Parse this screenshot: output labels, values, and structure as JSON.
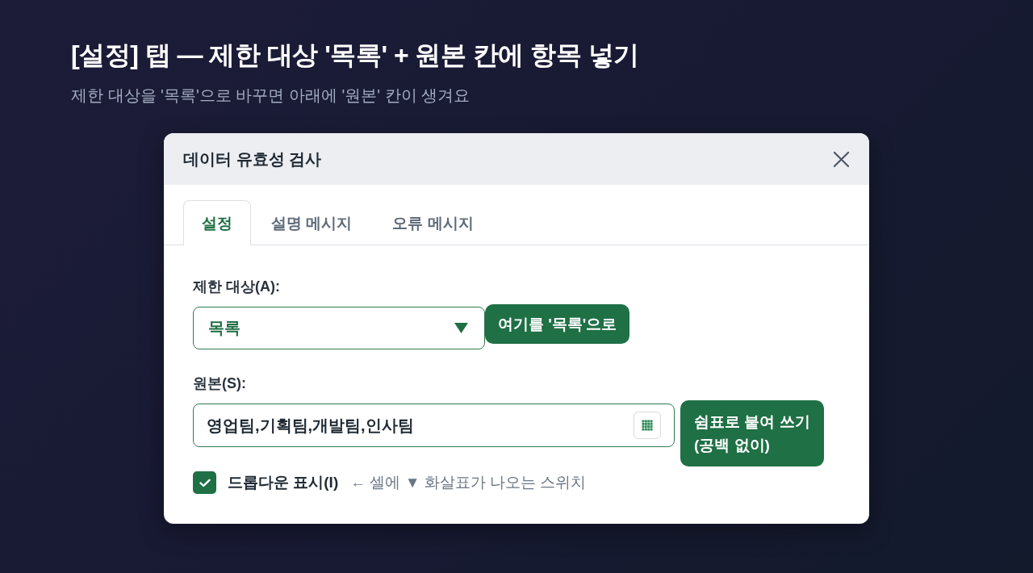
{
  "heading": {
    "title": "[설정] 탭 — 제한 대상 '목록' + 원본 칸에 항목 넣기",
    "subtitle": "제한 대상을 '목록'으로 바꾸면 아래에 '원본' 칸이 생겨요"
  },
  "dialog": {
    "title": "데이터 유효성 검사",
    "tabs": [
      {
        "label": "설정",
        "selected": true
      },
      {
        "label": "설명 메시지",
        "selected": false
      },
      {
        "label": "오류 메시지",
        "selected": false
      }
    ],
    "fields": [
      {
        "kind": "dropdown",
        "label": "제한 대상(A):",
        "value": "목록",
        "callout": "여기를 '목록'으로"
      },
      {
        "kind": "range",
        "label": "원본(S):",
        "value": "영업팀,기획팀,개발팀,인사팀",
        "callout": "쉼표로 붙여 쓰기\n(공백 없이)"
      }
    ],
    "checkbox": {
      "label": "드롭다운 표시(I)",
      "checked": true,
      "hint": "← 셀에 ▼ 화살표가 나오는 스위치"
    }
  }
}
